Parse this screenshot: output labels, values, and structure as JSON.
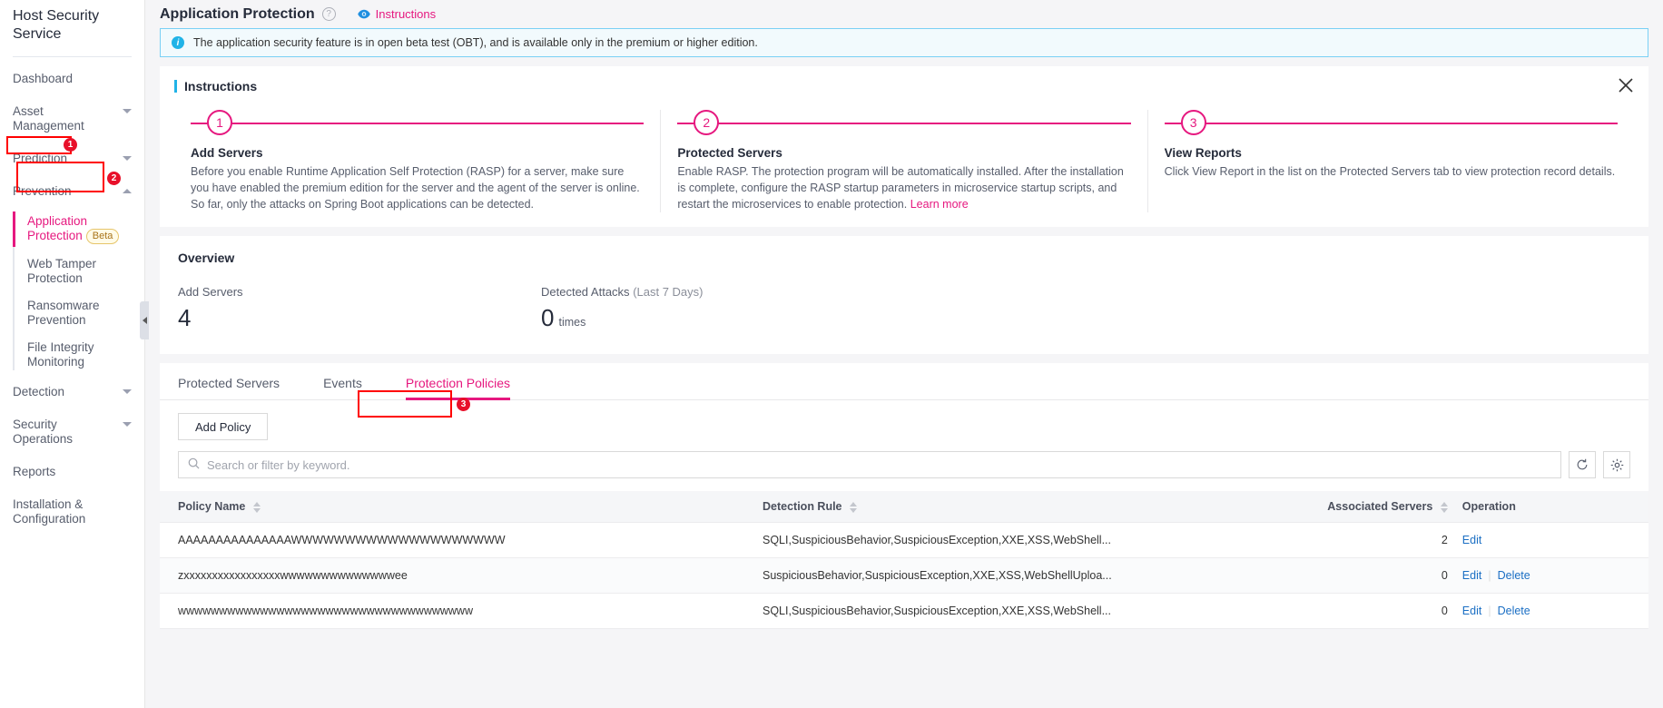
{
  "sidebar": {
    "service_title": "Host Security Service",
    "items": [
      {
        "label": "Dashboard",
        "expandable": false
      },
      {
        "label": "Asset Management",
        "expandable": true,
        "state": "collapsed"
      },
      {
        "label": "Prediction",
        "expandable": true,
        "state": "collapsed"
      },
      {
        "label": "Prevention",
        "expandable": true,
        "state": "expanded"
      }
    ],
    "prevention_children": [
      {
        "label": "Application Protection",
        "badge": "Beta",
        "active": true
      },
      {
        "label": "Web Tamper Protection",
        "active": false
      },
      {
        "label": "Ransomware Prevention",
        "active": false
      },
      {
        "label": "File Integrity Monitoring",
        "active": false
      }
    ],
    "items_after": [
      {
        "label": "Detection",
        "expandable": true,
        "state": "collapsed"
      },
      {
        "label": "Security Operations",
        "expandable": true,
        "state": "collapsed"
      },
      {
        "label": "Reports",
        "expandable": false
      },
      {
        "label": "Installation & Configuration",
        "expandable": false
      }
    ]
  },
  "header": {
    "title": "Application Protection",
    "help_icon": "question-circle-icon",
    "instructions_link": "Instructions",
    "eye_icon": "eye-icon"
  },
  "alert": {
    "icon": "info-icon",
    "text": "The application security feature is in open beta test (OBT), and is available only in the premium or higher edition."
  },
  "instructions": {
    "heading": "Instructions",
    "close_icon": "close-icon",
    "steps": [
      {
        "number": "1",
        "title": "Add Servers",
        "desc": "Before you enable Runtime Application Self Protection (RASP) for a server, make sure you have enabled the premium edition for the server and the agent of the server is online. So far, only the attacks on Spring Boot applications can be detected."
      },
      {
        "number": "2",
        "title": "Protected Servers",
        "desc": "Enable RASP. The protection program will be automatically installed. After the installation is complete, configure the RASP startup parameters in microservice startup scripts, and restart the microservices to enable protection.",
        "link": "Learn more"
      },
      {
        "number": "3",
        "title": "View Reports",
        "desc": "Click View Report in the list on the Protected Servers tab to view protection record details."
      }
    ]
  },
  "overview": {
    "title": "Overview",
    "add_servers_label": "Add Servers",
    "add_servers_value": "4",
    "detected_attacks_label": "Detected Attacks",
    "detected_attacks_period": "(Last 7 Days)",
    "detected_attacks_value": "0",
    "detected_attacks_unit": "times"
  },
  "tabs": [
    {
      "label": "Protected Servers",
      "active": false
    },
    {
      "label": "Events",
      "active": false
    },
    {
      "label": "Protection Policies",
      "active": true
    }
  ],
  "toolbar": {
    "add_policy_label": "Add Policy",
    "search_placeholder": "Search or filter by keyword.",
    "search_value": "",
    "search_icon": "search-icon",
    "refresh_icon": "refresh-icon",
    "settings_icon": "gear-icon"
  },
  "table": {
    "columns": [
      {
        "label": "Policy Name",
        "sortable": true,
        "align": "left"
      },
      {
        "label": "Detection Rule",
        "sortable": true,
        "align": "left"
      },
      {
        "label": "Associated Servers",
        "sortable": true,
        "align": "right"
      },
      {
        "label": "Operation",
        "sortable": false,
        "align": "left"
      }
    ],
    "rows": [
      {
        "policy_name": "AAAAAAAAAAAAAAAWWWWWWWWWWWWWWWWWWWW",
        "detection_rule": "SQLI,SuspiciousBehavior,SuspiciousException,XXE,XSS,WebShell...",
        "associated_servers": "2",
        "operations": [
          "Edit"
        ]
      },
      {
        "policy_name": "zxxxxxxxxxxxxxxxxxwwwwwwwwwwwwwwee",
        "detection_rule": "SuspiciousBehavior,SuspiciousException,XXE,XSS,WebShellUploa...",
        "associated_servers": "0",
        "operations": [
          "Edit",
          "Delete"
        ]
      },
      {
        "policy_name": "wwwwwwwwwwwwwwwwwwwwwwwwwwwwwwwwwwww",
        "detection_rule": "SQLI,SuspiciousBehavior,SuspiciousException,XXE,XSS,WebShell...",
        "associated_servers": "0",
        "operations": [
          "Edit",
          "Delete"
        ]
      }
    ]
  },
  "annotations": [
    {
      "number": "1",
      "target": "prevention-nav"
    },
    {
      "number": "2",
      "target": "application-protection-nav"
    },
    {
      "number": "3",
      "target": "protection-policies-tab"
    }
  ],
  "colors": {
    "accent": "#e6187f",
    "info": "#21b3e7",
    "link": "#1b6fc4",
    "annotation": "#ff0000",
    "annotation_badge": "#e8102a"
  }
}
